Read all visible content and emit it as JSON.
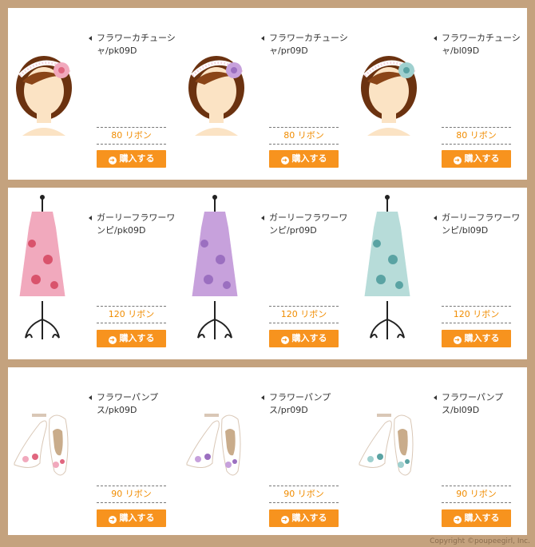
{
  "sections": [
    {
      "category": "headband",
      "items": [
        {
          "name": "フラワーカチューシャ/pk09D",
          "price": "80 リボン",
          "buy_label": "購入する",
          "color": "#f1a9bd",
          "dot": "#e0667f"
        },
        {
          "name": "フラワーカチューシャ/pr09D",
          "price": "80 リボン",
          "buy_label": "購入する",
          "color": "#c7a1dc",
          "dot": "#9b6fc0"
        },
        {
          "name": "フラワーカチューシャ/bl09D",
          "price": "80 リボン",
          "buy_label": "購入する",
          "color": "#9fd0cf",
          "dot": "#5aa3a3"
        }
      ]
    },
    {
      "category": "dress",
      "items": [
        {
          "name": "ガーリーフラワーワンピ/pk09D",
          "price": "120 リボン",
          "buy_label": "購入する",
          "color": "#f1a9bd",
          "dot": "#d9536c"
        },
        {
          "name": "ガーリーフラワーワンピ/pr09D",
          "price": "120 リボン",
          "buy_label": "購入する",
          "color": "#c7a1dc",
          "dot": "#9b6fc0"
        },
        {
          "name": "ガーリーフラワーワンピ/bl09D",
          "price": "120 リボン",
          "buy_label": "購入する",
          "color": "#b7dcd9",
          "dot": "#5aa3a3"
        }
      ]
    },
    {
      "category": "shoes",
      "items": [
        {
          "name": "フラワーパンプス/pk09D",
          "price": "90 リボン",
          "buy_label": "購入する",
          "color": "#f1a9bd",
          "dot": "#e0667f"
        },
        {
          "name": "フラワーパンプス/pr09D",
          "price": "90 リボン",
          "buy_label": "購入する",
          "color": "#c7a1dc",
          "dot": "#9b6fc0"
        },
        {
          "name": "フラワーパンプス/bl09D",
          "price": "90 リボン",
          "buy_label": "購入する",
          "color": "#9fd0cf",
          "dot": "#5aa3a3"
        }
      ]
    }
  ],
  "copyright": "Copyright ©poupeegirl, Inc."
}
